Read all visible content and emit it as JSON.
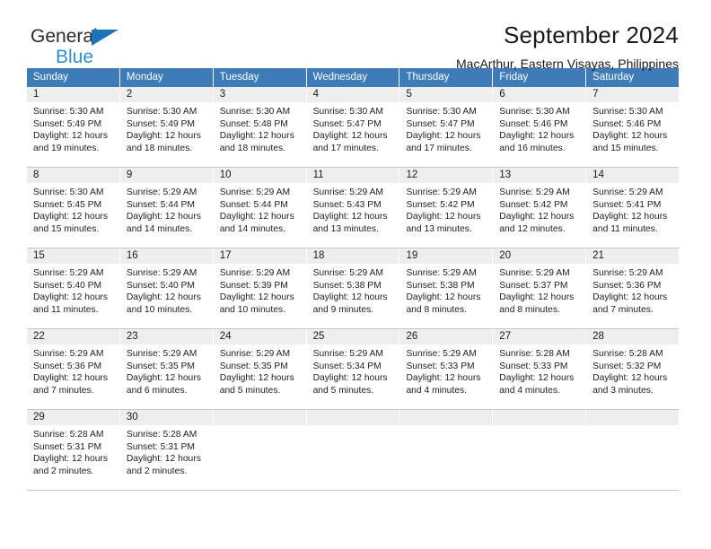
{
  "brand": {
    "name_part1": "General",
    "name_part2": "Blue",
    "accent_color": "#2e8fd4",
    "triangle_color": "#1c75bc"
  },
  "header": {
    "title": "September 2024",
    "subtitle": "MacArthur, Eastern Visayas, Philippines"
  },
  "calendar": {
    "header_bg_color": "#3d7cb9",
    "daynum_bg_color": "#eeeeee",
    "weekdays": [
      "Sunday",
      "Monday",
      "Tuesday",
      "Wednesday",
      "Thursday",
      "Friday",
      "Saturday"
    ],
    "weeks": [
      [
        {
          "day": "1",
          "sunrise": "Sunrise: 5:30 AM",
          "sunset": "Sunset: 5:49 PM",
          "daylight_line1": "Daylight: 12 hours",
          "daylight_line2": "and 19 minutes."
        },
        {
          "day": "2",
          "sunrise": "Sunrise: 5:30 AM",
          "sunset": "Sunset: 5:49 PM",
          "daylight_line1": "Daylight: 12 hours",
          "daylight_line2": "and 18 minutes."
        },
        {
          "day": "3",
          "sunrise": "Sunrise: 5:30 AM",
          "sunset": "Sunset: 5:48 PM",
          "daylight_line1": "Daylight: 12 hours",
          "daylight_line2": "and 18 minutes."
        },
        {
          "day": "4",
          "sunrise": "Sunrise: 5:30 AM",
          "sunset": "Sunset: 5:47 PM",
          "daylight_line1": "Daylight: 12 hours",
          "daylight_line2": "and 17 minutes."
        },
        {
          "day": "5",
          "sunrise": "Sunrise: 5:30 AM",
          "sunset": "Sunset: 5:47 PM",
          "daylight_line1": "Daylight: 12 hours",
          "daylight_line2": "and 17 minutes."
        },
        {
          "day": "6",
          "sunrise": "Sunrise: 5:30 AM",
          "sunset": "Sunset: 5:46 PM",
          "daylight_line1": "Daylight: 12 hours",
          "daylight_line2": "and 16 minutes."
        },
        {
          "day": "7",
          "sunrise": "Sunrise: 5:30 AM",
          "sunset": "Sunset: 5:46 PM",
          "daylight_line1": "Daylight: 12 hours",
          "daylight_line2": "and 15 minutes."
        }
      ],
      [
        {
          "day": "8",
          "sunrise": "Sunrise: 5:30 AM",
          "sunset": "Sunset: 5:45 PM",
          "daylight_line1": "Daylight: 12 hours",
          "daylight_line2": "and 15 minutes."
        },
        {
          "day": "9",
          "sunrise": "Sunrise: 5:29 AM",
          "sunset": "Sunset: 5:44 PM",
          "daylight_line1": "Daylight: 12 hours",
          "daylight_line2": "and 14 minutes."
        },
        {
          "day": "10",
          "sunrise": "Sunrise: 5:29 AM",
          "sunset": "Sunset: 5:44 PM",
          "daylight_line1": "Daylight: 12 hours",
          "daylight_line2": "and 14 minutes."
        },
        {
          "day": "11",
          "sunrise": "Sunrise: 5:29 AM",
          "sunset": "Sunset: 5:43 PM",
          "daylight_line1": "Daylight: 12 hours",
          "daylight_line2": "and 13 minutes."
        },
        {
          "day": "12",
          "sunrise": "Sunrise: 5:29 AM",
          "sunset": "Sunset: 5:42 PM",
          "daylight_line1": "Daylight: 12 hours",
          "daylight_line2": "and 13 minutes."
        },
        {
          "day": "13",
          "sunrise": "Sunrise: 5:29 AM",
          "sunset": "Sunset: 5:42 PM",
          "daylight_line1": "Daylight: 12 hours",
          "daylight_line2": "and 12 minutes."
        },
        {
          "day": "14",
          "sunrise": "Sunrise: 5:29 AM",
          "sunset": "Sunset: 5:41 PM",
          "daylight_line1": "Daylight: 12 hours",
          "daylight_line2": "and 11 minutes."
        }
      ],
      [
        {
          "day": "15",
          "sunrise": "Sunrise: 5:29 AM",
          "sunset": "Sunset: 5:40 PM",
          "daylight_line1": "Daylight: 12 hours",
          "daylight_line2": "and 11 minutes."
        },
        {
          "day": "16",
          "sunrise": "Sunrise: 5:29 AM",
          "sunset": "Sunset: 5:40 PM",
          "daylight_line1": "Daylight: 12 hours",
          "daylight_line2": "and 10 minutes."
        },
        {
          "day": "17",
          "sunrise": "Sunrise: 5:29 AM",
          "sunset": "Sunset: 5:39 PM",
          "daylight_line1": "Daylight: 12 hours",
          "daylight_line2": "and 10 minutes."
        },
        {
          "day": "18",
          "sunrise": "Sunrise: 5:29 AM",
          "sunset": "Sunset: 5:38 PM",
          "daylight_line1": "Daylight: 12 hours",
          "daylight_line2": "and 9 minutes."
        },
        {
          "day": "19",
          "sunrise": "Sunrise: 5:29 AM",
          "sunset": "Sunset: 5:38 PM",
          "daylight_line1": "Daylight: 12 hours",
          "daylight_line2": "and 8 minutes."
        },
        {
          "day": "20",
          "sunrise": "Sunrise: 5:29 AM",
          "sunset": "Sunset: 5:37 PM",
          "daylight_line1": "Daylight: 12 hours",
          "daylight_line2": "and 8 minutes."
        },
        {
          "day": "21",
          "sunrise": "Sunrise: 5:29 AM",
          "sunset": "Sunset: 5:36 PM",
          "daylight_line1": "Daylight: 12 hours",
          "daylight_line2": "and 7 minutes."
        }
      ],
      [
        {
          "day": "22",
          "sunrise": "Sunrise: 5:29 AM",
          "sunset": "Sunset: 5:36 PM",
          "daylight_line1": "Daylight: 12 hours",
          "daylight_line2": "and 7 minutes."
        },
        {
          "day": "23",
          "sunrise": "Sunrise: 5:29 AM",
          "sunset": "Sunset: 5:35 PM",
          "daylight_line1": "Daylight: 12 hours",
          "daylight_line2": "and 6 minutes."
        },
        {
          "day": "24",
          "sunrise": "Sunrise: 5:29 AM",
          "sunset": "Sunset: 5:35 PM",
          "daylight_line1": "Daylight: 12 hours",
          "daylight_line2": "and 5 minutes."
        },
        {
          "day": "25",
          "sunrise": "Sunrise: 5:29 AM",
          "sunset": "Sunset: 5:34 PM",
          "daylight_line1": "Daylight: 12 hours",
          "daylight_line2": "and 5 minutes."
        },
        {
          "day": "26",
          "sunrise": "Sunrise: 5:29 AM",
          "sunset": "Sunset: 5:33 PM",
          "daylight_line1": "Daylight: 12 hours",
          "daylight_line2": "and 4 minutes."
        },
        {
          "day": "27",
          "sunrise": "Sunrise: 5:28 AM",
          "sunset": "Sunset: 5:33 PM",
          "daylight_line1": "Daylight: 12 hours",
          "daylight_line2": "and 4 minutes."
        },
        {
          "day": "28",
          "sunrise": "Sunrise: 5:28 AM",
          "sunset": "Sunset: 5:32 PM",
          "daylight_line1": "Daylight: 12 hours",
          "daylight_line2": "and 3 minutes."
        }
      ],
      [
        {
          "day": "29",
          "sunrise": "Sunrise: 5:28 AM",
          "sunset": "Sunset: 5:31 PM",
          "daylight_line1": "Daylight: 12 hours",
          "daylight_line2": "and 2 minutes."
        },
        {
          "day": "30",
          "sunrise": "Sunrise: 5:28 AM",
          "sunset": "Sunset: 5:31 PM",
          "daylight_line1": "Daylight: 12 hours",
          "daylight_line2": "and 2 minutes."
        },
        {
          "day": "",
          "sunrise": "",
          "sunset": "",
          "daylight_line1": "",
          "daylight_line2": ""
        },
        {
          "day": "",
          "sunrise": "",
          "sunset": "",
          "daylight_line1": "",
          "daylight_line2": ""
        },
        {
          "day": "",
          "sunrise": "",
          "sunset": "",
          "daylight_line1": "",
          "daylight_line2": ""
        },
        {
          "day": "",
          "sunrise": "",
          "sunset": "",
          "daylight_line1": "",
          "daylight_line2": ""
        },
        {
          "day": "",
          "sunrise": "",
          "sunset": "",
          "daylight_line1": "",
          "daylight_line2": ""
        }
      ]
    ]
  }
}
